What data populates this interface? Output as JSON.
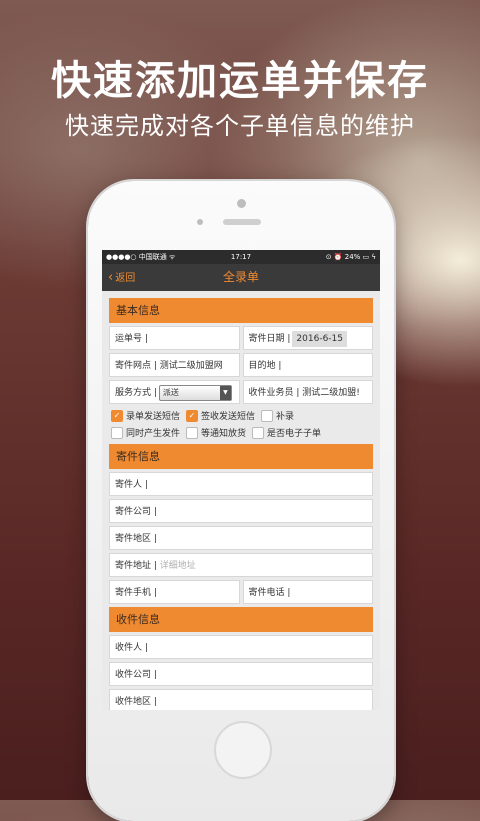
{
  "hero": {
    "title": "快速添加运单并保存",
    "subtitle": "快速完成对各个子单信息的维护"
  },
  "status_bar": {
    "carrier": "●●●●○ 中国联通 ᯤ",
    "time": "17:17",
    "battery": "⊙ ⏰ 24% ▭ ϟ"
  },
  "nav": {
    "back_label": "返回",
    "back_icon": "‹",
    "title": "全录单"
  },
  "sections": {
    "basic": "基本信息",
    "sender": "寄件信息",
    "receiver": "收件信息"
  },
  "basic": {
    "waybill_label": "运单号",
    "ship_date_label": "寄件日期",
    "ship_date_value": "2016-6-15",
    "ship_outlet_label": "寄件网点",
    "ship_outlet_value": "测试二级加盟网",
    "destination_label": "目的地",
    "service_label": "服务方式",
    "service_value": "派送",
    "courier_label": "收件业务员",
    "courier_value": "测试二级加盟!"
  },
  "checkboxes": [
    {
      "label": "录单发送短信",
      "checked": true
    },
    {
      "label": "签收发送短信",
      "checked": true
    },
    {
      "label": "补录",
      "checked": false
    },
    {
      "label": "同时产生发件",
      "checked": false
    },
    {
      "label": "等通知放货",
      "checked": false
    },
    {
      "label": "是否电子子单",
      "checked": false
    }
  ],
  "sender": {
    "name_label": "寄件人",
    "company_label": "寄件公司",
    "region_label": "寄件地区",
    "address_label": "寄件地址",
    "address_placeholder": "详细地址",
    "mobile_label": "寄件手机",
    "phone_label": "寄件电话"
  },
  "receiver": {
    "name_label": "收件人",
    "company_label": "收件公司",
    "region_label": "收件地区"
  },
  "colors": {
    "accent": "#f08a30",
    "navbar": "#3a3a3a"
  }
}
